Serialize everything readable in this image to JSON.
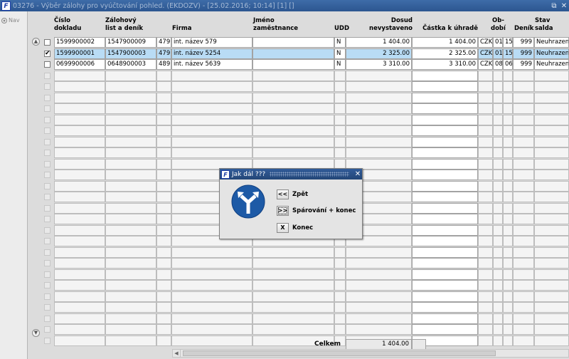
{
  "window": {
    "title": "03276 - Výběr zálohy pro vyúčtování pohled. (EKDOZV) - [25.02.2016; 10:14]  [1] []"
  },
  "sidebar": {
    "nav_label": "Nav"
  },
  "columns": {
    "cislo": "Číslo\ndokladu",
    "zalohovy": "Zálohový\nlist a deník",
    "firma": "Firma",
    "jmeno": "Jméno\nzaměstnance",
    "udd": "UDD",
    "dosud": "Dosud\nnevystaveno",
    "castka": "Částka k úhradě",
    "obdobi": "Ob-\ndobí",
    "denik": "Deník",
    "stav": "Stav\nsalda"
  },
  "rows": [
    {
      "checked": false,
      "cislo": "1599900002",
      "zalohovy": "1547900009",
      "num": "479",
      "firma": "int. název 579",
      "jmeno": "",
      "udd": "N",
      "dosud": "1 404.00",
      "castka": "1 404.00",
      "mena": "CZK",
      "ob1": "01",
      "ob2": "15",
      "denik": "999",
      "stav": "Neuhrazené",
      "check_mark": ""
    },
    {
      "checked": true,
      "cislo": "1599900001",
      "zalohovy": "1547900003",
      "num": "479",
      "firma": "int. název 5254",
      "jmeno": "",
      "udd": "N",
      "dosud": "2 325.00",
      "castka": "2 325.00",
      "mena": "CZK",
      "ob1": "01",
      "ob2": "15",
      "denik": "999",
      "stav": "Neuhrazené",
      "check_mark": "✔"
    },
    {
      "checked": false,
      "cislo": "0699900006",
      "zalohovy": "0648900003",
      "num": "489",
      "firma": "int. název 5639",
      "jmeno": "",
      "udd": "N",
      "dosud": "3 310.00",
      "castka": "3 310.00",
      "mena": "CZK",
      "ob1": "08",
      "ob2": "06",
      "denik": "999",
      "stav": "Neuhrazené",
      "check_mark": ""
    }
  ],
  "footer": {
    "celkem_label": "Celkem",
    "celkem_value": "1 404.00"
  },
  "dialog": {
    "title": "Jak dál ???",
    "buttons": [
      {
        "glyph": "<<",
        "label": "Zpět"
      },
      {
        "glyph": ">>",
        "label": "Spárování + konec"
      },
      {
        "glyph": "X",
        "label": "Konec"
      }
    ]
  },
  "colors": {
    "titlebar": "#2c5690",
    "selected_row": "#b9dcf5",
    "sign_blue": "#1d5aa6"
  },
  "icons": {
    "app": "app-logo-icon",
    "sign": "fork-arrow-sign-icon",
    "nav": "radio-nav-icon"
  }
}
